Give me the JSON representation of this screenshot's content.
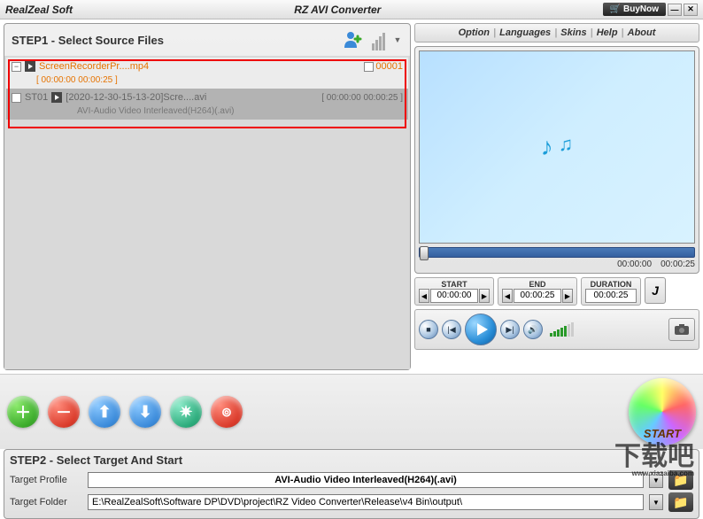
{
  "titlebar": {
    "brand": "RealZeal Soft",
    "app": "RZ AVI Converter",
    "buynow": "BuyNow"
  },
  "menu": {
    "option": "Option",
    "languages": "Languages",
    "skins": "Skins",
    "help": "Help",
    "about": "About"
  },
  "step1": {
    "title": "STEP1 - Select Source Files",
    "file1_name": "ScreenRecorderPr....mp4",
    "file1_num": "00001",
    "file1_range": "[ 00:00:00  00:00:25 ]",
    "file2_prefix": "ST01",
    "file2_name": "[2020-12-30-15-13-20]Scre....avi",
    "file2_range": "[ 00:00:00  00:00:25 ]",
    "file2_sub": "AVI-Audio Video Interleaved(H264)(.avi)"
  },
  "preview": {
    "time_cur": "00:00:00",
    "time_total": "00:00:25"
  },
  "clip": {
    "start_label": "START",
    "start_val": "00:00:00",
    "end_label": "END",
    "end_val": "00:00:25",
    "duration_label": "DURATION",
    "duration_val": "00:00:25"
  },
  "step2": {
    "title": "STEP2 - Select Target And Start",
    "profile_label": "Target Profile",
    "profile_value": "AVI-Audio Video Interleaved(H264)(.avi)",
    "folder_label": "Target Folder",
    "folder_value": "E:\\RealZealSoft\\Software DP\\DVD\\project\\RZ Video Converter\\Release\\v4 Bin\\output\\",
    "start": "START"
  },
  "watermark": {
    "text": "下载吧",
    "url": "www.xiazaiba.com"
  }
}
